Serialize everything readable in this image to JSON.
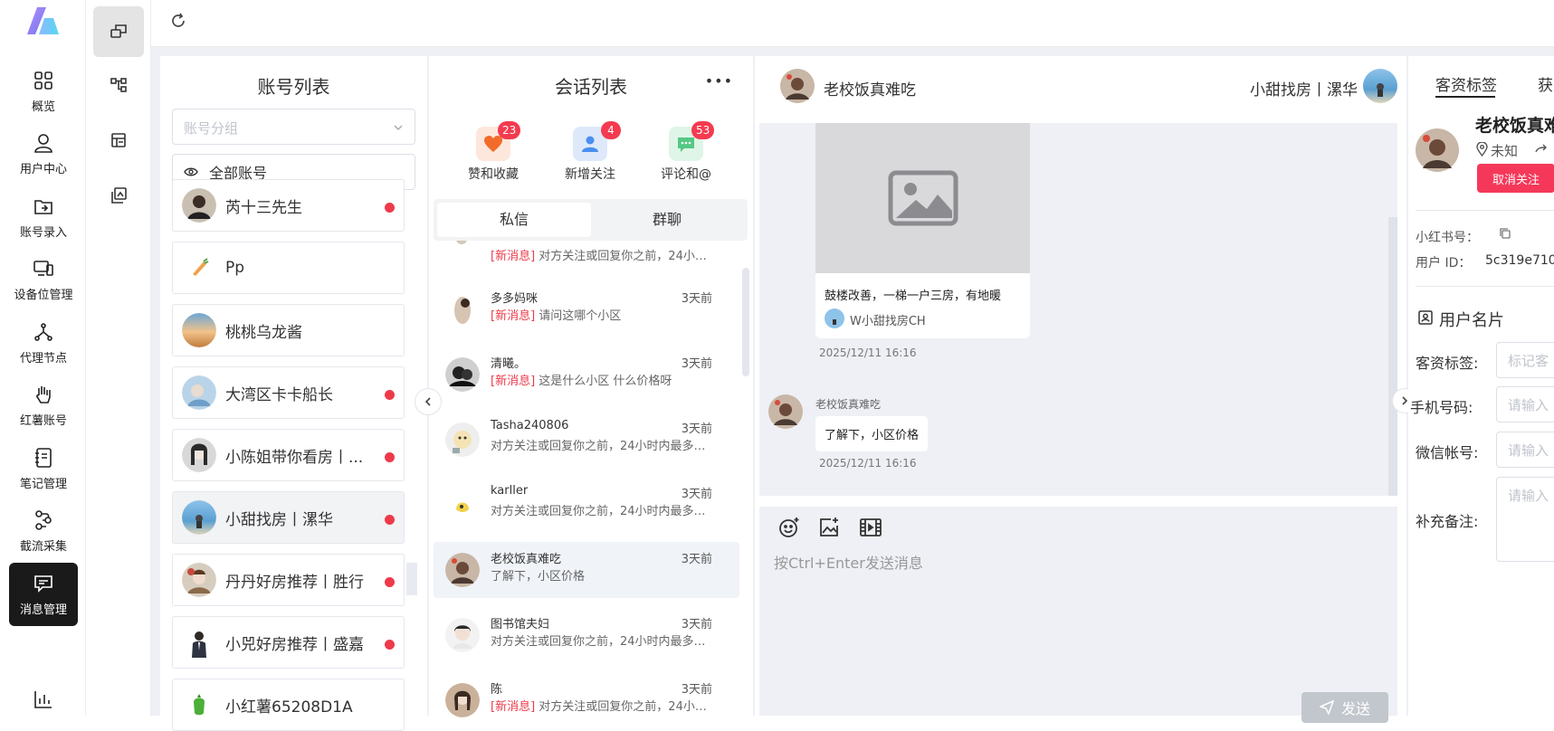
{
  "sidebar": {
    "items": [
      {
        "label": "概览",
        "icon": "grid-icon"
      },
      {
        "label": "用户中心",
        "icon": "user-icon"
      },
      {
        "label": "账号录入",
        "icon": "import-icon"
      },
      {
        "label": "设备位管理",
        "icon": "devices-icon"
      },
      {
        "label": "代理节点",
        "icon": "nodes-icon"
      },
      {
        "label": "红薯账号",
        "icon": "hand-icon"
      },
      {
        "label": "笔记管理",
        "icon": "notebook-icon"
      },
      {
        "label": "截流采集",
        "icon": "flow-icon"
      },
      {
        "label": "消息管理",
        "icon": "message-icon",
        "active": true
      }
    ]
  },
  "accounts": {
    "title": "账号列表",
    "group_placeholder": "账号分组",
    "all_label": "全部账号",
    "items": [
      {
        "name": "芮十三先生",
        "unread": true
      },
      {
        "name": "Pp",
        "unread": false
      },
      {
        "name": "桃桃乌龙酱",
        "unread": false
      },
      {
        "name": "大湾区卡卡船长",
        "unread": true
      },
      {
        "name": "小陈姐带你看房丨...",
        "unread": true
      },
      {
        "name": "小甜找房丨漯华",
        "unread": true,
        "selected": true
      },
      {
        "name": "丹丹好房推荐丨胜行",
        "unread": true
      },
      {
        "name": "小兕好房推荐丨盛嘉",
        "unread": true
      },
      {
        "name": "小红薯65208D1A",
        "unread": false
      }
    ]
  },
  "conversations": {
    "title": "会话列表",
    "more_label": "•••",
    "categories": [
      {
        "label": "赞和收藏",
        "count": "23"
      },
      {
        "label": "新增关注",
        "count": "4"
      },
      {
        "label": "评论和@",
        "count": "53"
      }
    ],
    "tabs": [
      "私信",
      "群聊"
    ],
    "partial_item": {
      "tag": "[新消息]",
      "msg": "对方关注或回复你之前，24小时..."
    },
    "items": [
      {
        "name": "多多妈咪",
        "time": "3天前",
        "tag": "[新消息]",
        "msg": "请问这哪个小区"
      },
      {
        "name": "清曦。",
        "time": "3天前",
        "tag": "[新消息]",
        "msg": "这是什么小区 什么价格呀"
      },
      {
        "name": "Tasha240806",
        "time": "3天前",
        "tag": "",
        "msg": "对方关注或回复你之前，24小时内最多只..."
      },
      {
        "name": "karller",
        "time": "3天前",
        "tag": "",
        "msg": "对方关注或回复你之前，24小时内最多只..."
      },
      {
        "name": "老校饭真难吃",
        "time": "3天前",
        "tag": "",
        "msg": "了解下，小区价格",
        "selected": true
      },
      {
        "name": "图书馆夫妇",
        "time": "3天前",
        "tag": "",
        "msg": "对方关注或回复你之前，24小时内最多只..."
      },
      {
        "name": "陈",
        "time": "3天前",
        "tag": "[新消息]",
        "msg": "对方关注或回复你之前，24小时..."
      }
    ]
  },
  "chat": {
    "peer_name": "老校饭真难吃",
    "self_name": "小甜找房丨漯华",
    "card_title": "鼓楼改善，一梯一户三房，有地暖",
    "card_author": "W小甜找房CH",
    "card_time": "2025/12/11 16:16",
    "msg_sender": "老校饭真难吃",
    "msg_text": "了解下，小区价格",
    "msg_time": "2025/12/11 16:16",
    "input_placeholder": "按Ctrl+Enter发送消息",
    "send_label": "发送"
  },
  "info": {
    "tabs": [
      "客资标签",
      "获"
    ],
    "name": "老校饭真难",
    "location": "未知",
    "unfollow_label": "取消关注",
    "xhs_label": "小红书号：",
    "uid_label": "用户 ID：",
    "uid_value": "5c319e710",
    "card_title": "用户名片",
    "fields": [
      {
        "label": "客资标签:",
        "placeholder": "标记客"
      },
      {
        "label": "手机号码:",
        "placeholder": "请输入"
      },
      {
        "label": "微信帐号:",
        "placeholder": "请输入"
      },
      {
        "label": "补充备注:",
        "placeholder": "请输入"
      }
    ]
  },
  "colors": {
    "accent_red": "#f53a4f",
    "active_nav": "#1a1a1a",
    "new_tag": "#ee3a4a"
  }
}
